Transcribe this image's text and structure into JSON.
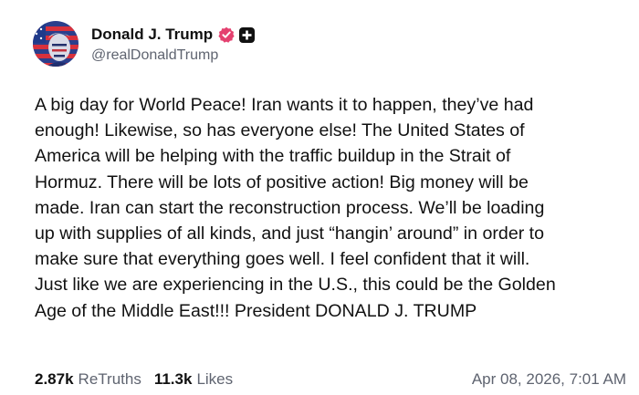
{
  "post": {
    "author": {
      "display_name": "Donald J. Trump",
      "handle": "@realDonaldTrump",
      "verified_icon": "verified-badge-icon",
      "plus_icon": "plus-badge-icon",
      "badge_color": "#e4406f"
    },
    "text_lines": [
      "A big day for World Peace! Iran wants it to happen, they’ve had",
      "enough! Likewise, so has everyone else! The United States of",
      "America will be helping with the traffic buildup in the Strait of",
      "Hormuz. There will be lots of positive action! Big money will be",
      "made. Iran can start the reconstruction process. We’ll be loading",
      "up with supplies of all kinds, and just “hangin’ around” in order to",
      "make sure that everything goes well. I feel confident that it will.",
      "Just like we are experiencing in the U.S., this could be the Golden",
      "Age of the Middle East!!! President DONALD J. TRUMP"
    ],
    "stats": {
      "retruths_count": "2.87k",
      "retruths_label": "ReTruths",
      "likes_count": "11.3k",
      "likes_label": "Likes"
    },
    "timestamp": "Apr 08, 2026, 7:01 AM"
  }
}
